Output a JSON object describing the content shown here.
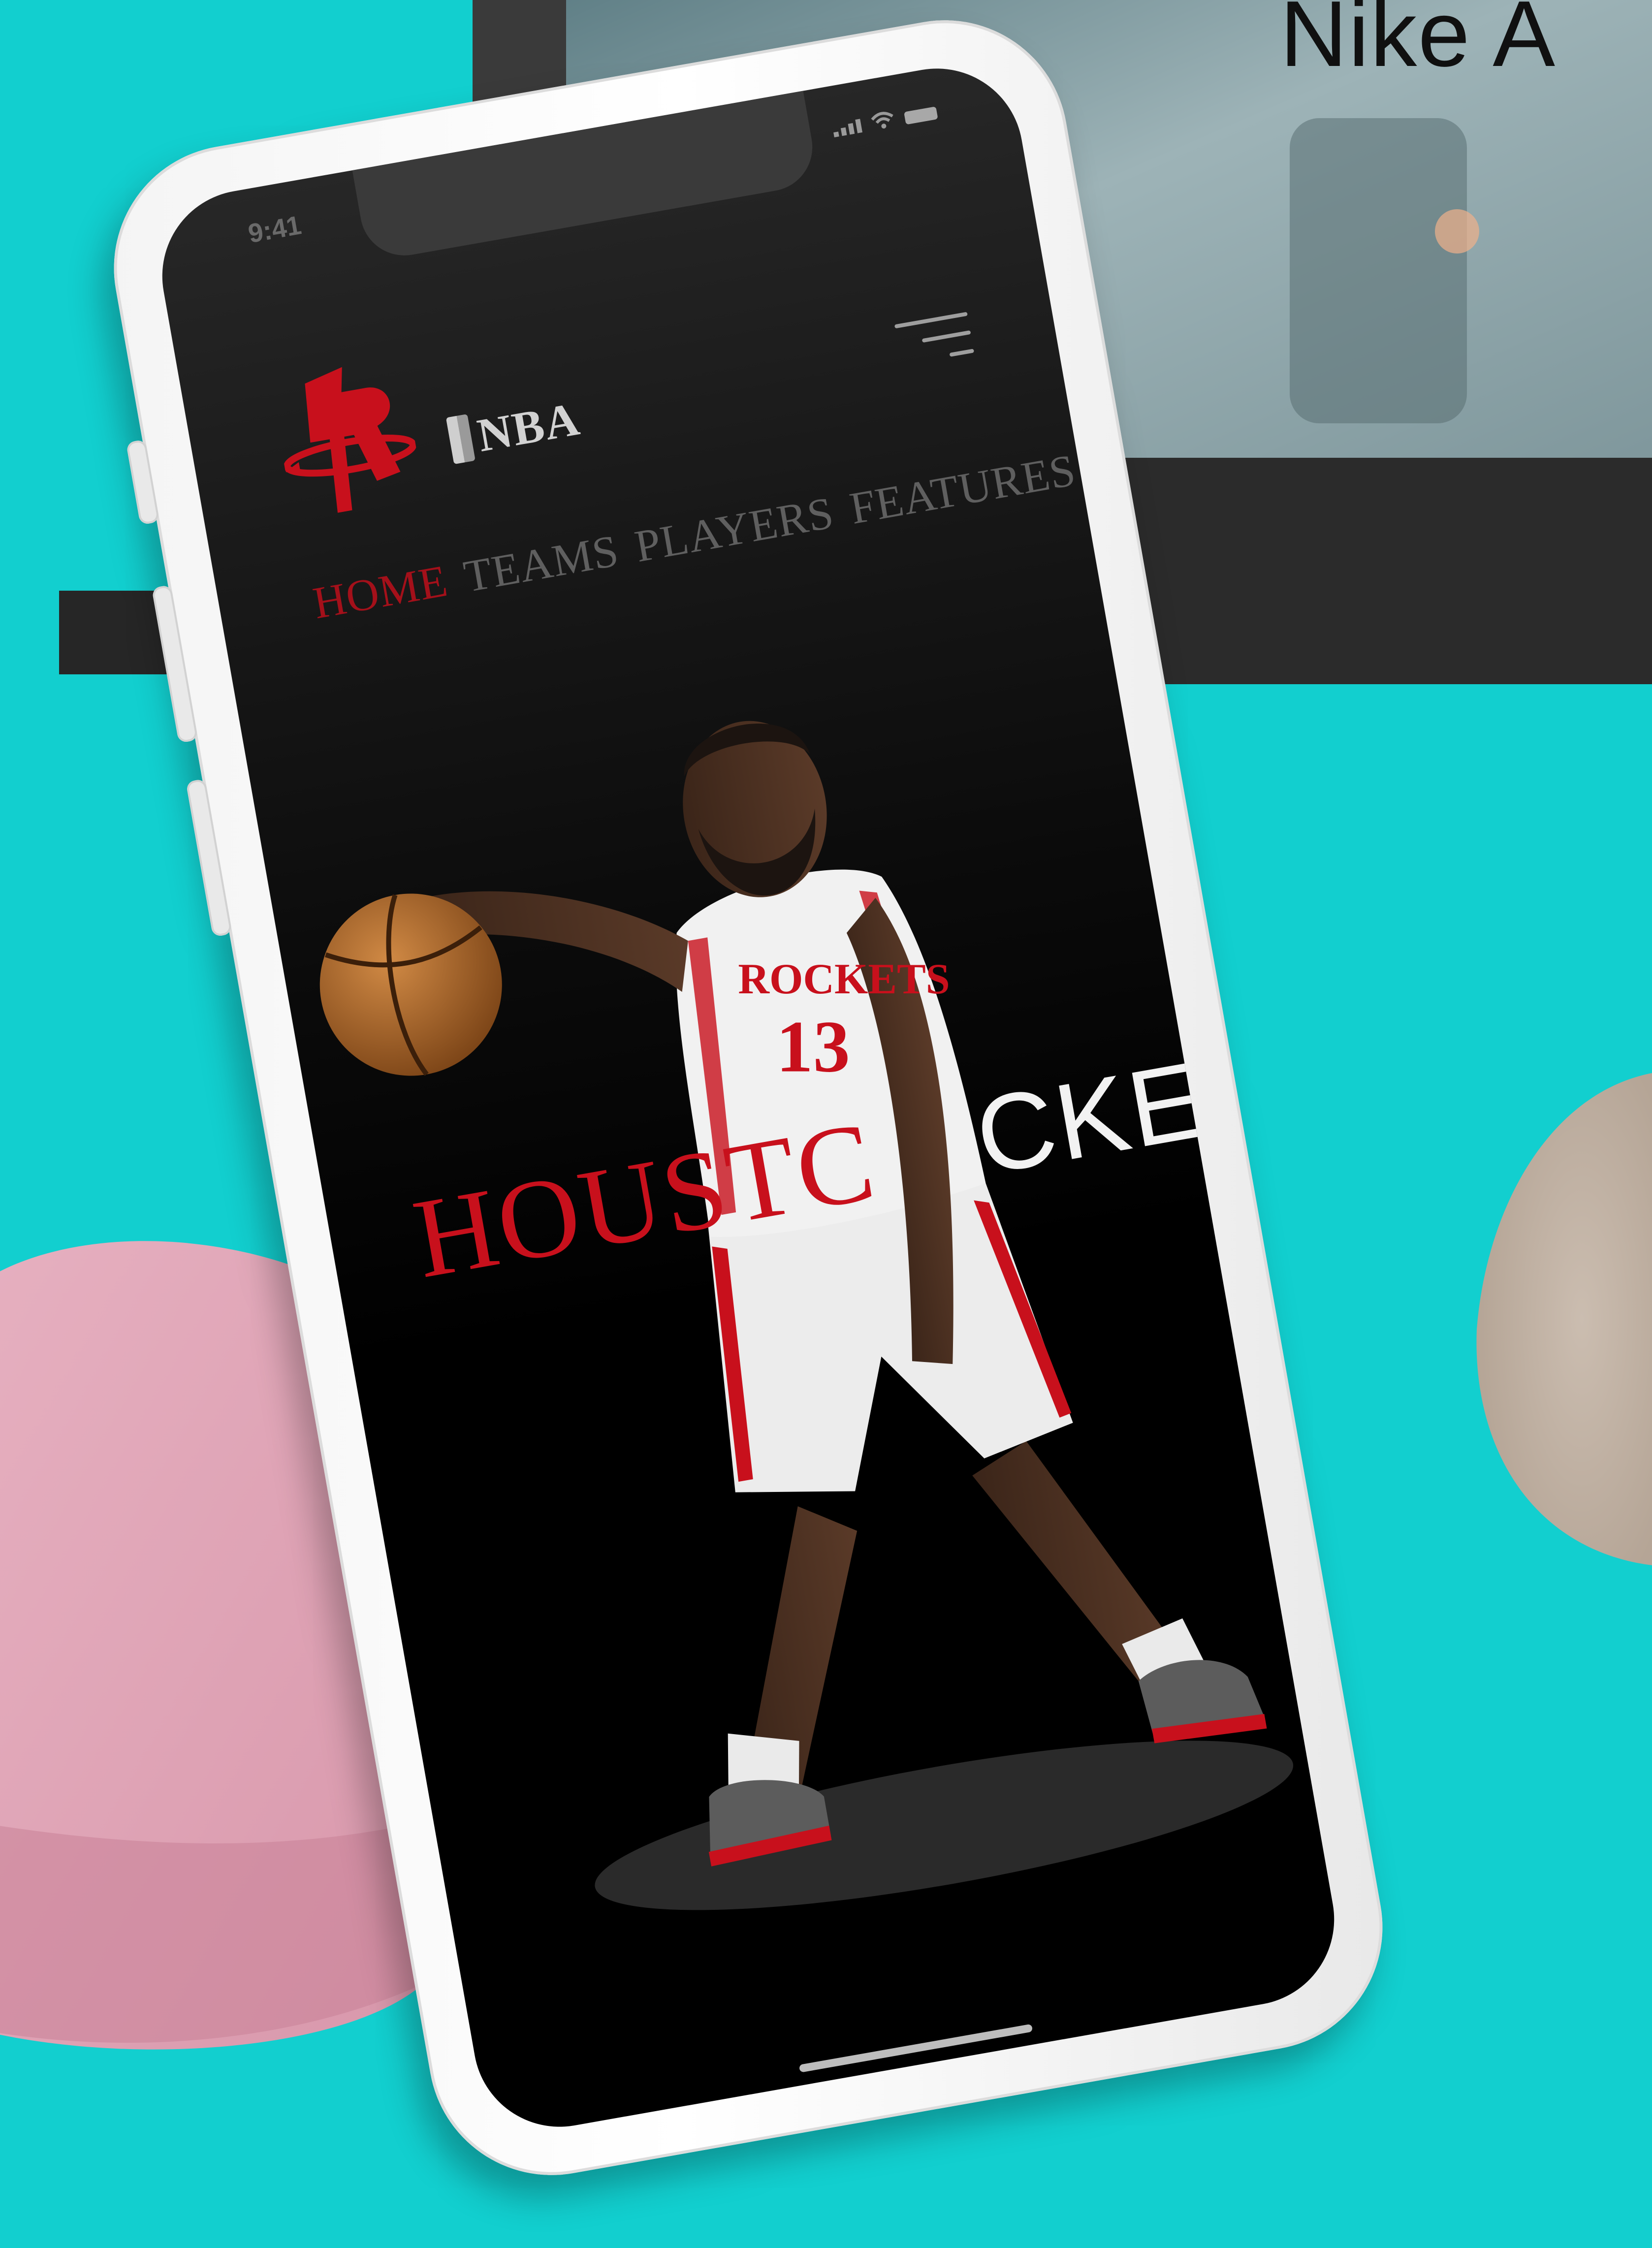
{
  "backdrop": {
    "caption": "Nike A",
    "colors": {
      "background": "#12cfcf",
      "pink_blob": "#e2a9ba",
      "beige_blob": "#c2b2a4"
    }
  },
  "phone": {
    "status_bar": {
      "time": "9:41",
      "icons": [
        "signal-icon",
        "wifi-icon",
        "battery-icon"
      ]
    },
    "header": {
      "logo": "rockets-logo",
      "league_mark": "NBA",
      "menu_icon": "hamburger-menu-icon"
    },
    "nav": {
      "items": [
        {
          "label": "HOME",
          "active": true
        },
        {
          "label": "TEAMS",
          "active": false
        },
        {
          "label": "PLAYERS",
          "active": false
        },
        {
          "label": "FEATURES",
          "active": false
        }
      ]
    },
    "hero": {
      "title_left": "HOUSTC",
      "title_right": "CKET",
      "jersey_name": "ROCKETS",
      "jersey_number": "13"
    },
    "colors": {
      "accent": "#c8101c",
      "screen_background": "#000000",
      "nav_text": "#5f5f5f"
    }
  }
}
